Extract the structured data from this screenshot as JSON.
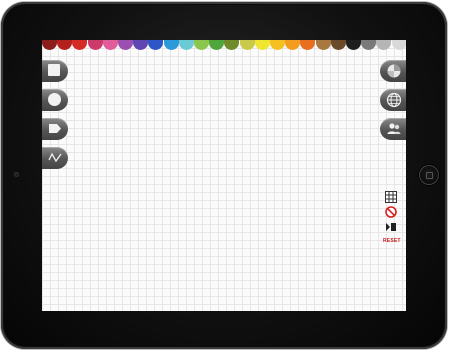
{
  "palette": {
    "colors": [
      "#8c1d1d",
      "#b3201d",
      "#d42b24",
      "#cc3a6b",
      "#e05c9b",
      "#9c4fb0",
      "#5e47b3",
      "#2f56c6",
      "#2a9bd8",
      "#6ccad6",
      "#8ac64b",
      "#4fa63b",
      "#6f8a2a",
      "#c9c94a",
      "#f0e632",
      "#f5c122",
      "#f39c1f",
      "#e86f1f",
      "#a8783e",
      "#6b4a2a",
      "#1e1e1e",
      "#7a7a7a",
      "#b5b5b5",
      "#d9d9d9"
    ]
  },
  "left_tools": [
    {
      "icon": "rectangle-tool-icon"
    },
    {
      "icon": "circle-tool-icon"
    },
    {
      "icon": "tag-shape-tool-icon"
    },
    {
      "icon": "freehand-line-tool-icon"
    }
  ],
  "right_tools": [
    {
      "icon": "color-picker-icon"
    },
    {
      "icon": "globe-icon"
    },
    {
      "icon": "people-icon"
    }
  ],
  "utility": {
    "reset_label": "RESET"
  }
}
